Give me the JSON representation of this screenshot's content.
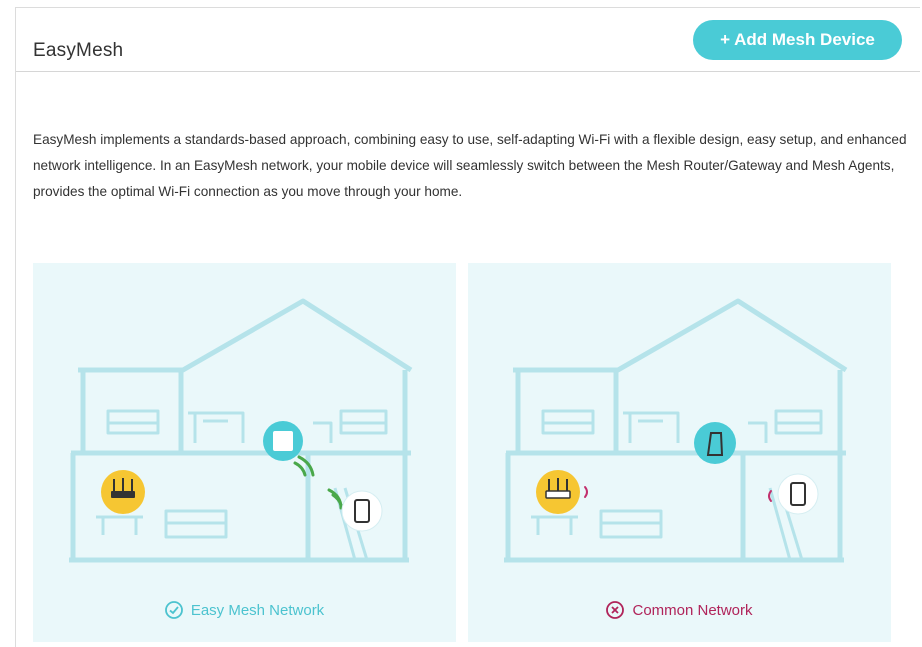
{
  "header": {
    "title": "EasyMesh",
    "add_button_label": "+ Add Mesh Device"
  },
  "description": "EasyMesh implements a standards-based approach, combining easy to use, self-adapting Wi-Fi with a flexible design, easy setup, and enhanced network intelligence. In an EasyMesh network, your mobile device will seamlessly switch between the Mesh Router/Gateway and Mesh Agents, provides the optimal Wi-Fi connection as you move through your home.",
  "illustrations": [
    {
      "caption": "Easy Mesh Network",
      "status_icon": "check-circle-icon"
    },
    {
      "caption": "Common Network",
      "status_icon": "x-circle-icon"
    }
  ],
  "colors": {
    "accent": "#4acbd6",
    "house_line": "#b5e3ea",
    "router_yellow": "#f6c632",
    "ok_teal": "#4cc3cf",
    "error_red": "#b0245a"
  }
}
